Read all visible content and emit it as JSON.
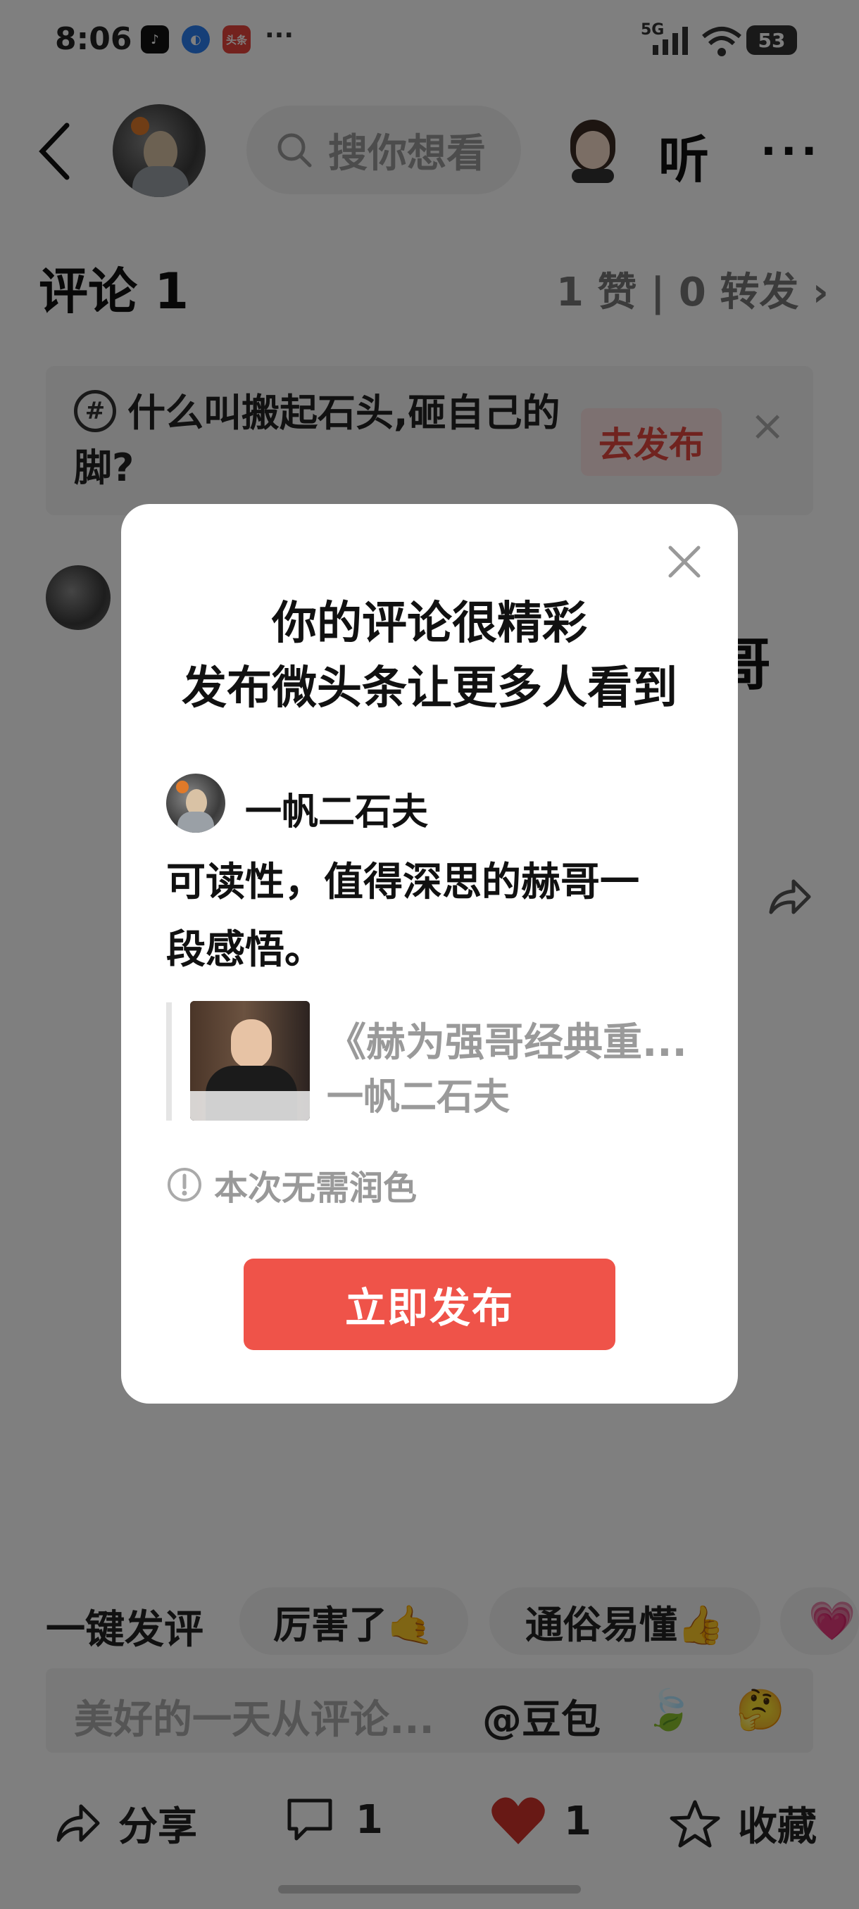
{
  "status_bar": {
    "time": "8:06",
    "network": "5G",
    "battery": "53",
    "more": "···",
    "toutiao_icon_text": "头条"
  },
  "header": {
    "search_placeholder": "搜你想看",
    "listen_label": "听",
    "more_label": "···"
  },
  "comment_section": {
    "title": "评论 1",
    "stats": "1 赞 | 0 转发 ›"
  },
  "topic_bar": {
    "text": "什么叫搬起石头,砸自己的脚?",
    "publish_label": "去发布",
    "close_label": "×"
  },
  "background_fragment": "哥",
  "quick_replies": {
    "label": "一键发评",
    "items": [
      "厉害了🤙",
      "通俗易懂👍",
      "💗"
    ]
  },
  "input_bar": {
    "placeholder": "美好的一天从评论...",
    "doubao_label": "@豆包"
  },
  "bottom_bar": {
    "share_label": "分享",
    "comment_count": "1",
    "like_count": "1",
    "favorite_label": "收藏",
    "like_color": "#d0322a"
  },
  "modal": {
    "title_line1": "你的评论很精彩",
    "title_line2": "发布微头条让更多人看到",
    "author_name": "一帆二石夫",
    "body_line1": "可读性，值得深思的赫哥一",
    "body_line2": "段感悟。",
    "quote_title": "《赫为强哥经典重...",
    "quote_author": "一帆二石夫",
    "note": "本次无需润色",
    "publish_button": "立即发布",
    "accent_color": "#ef5349"
  }
}
